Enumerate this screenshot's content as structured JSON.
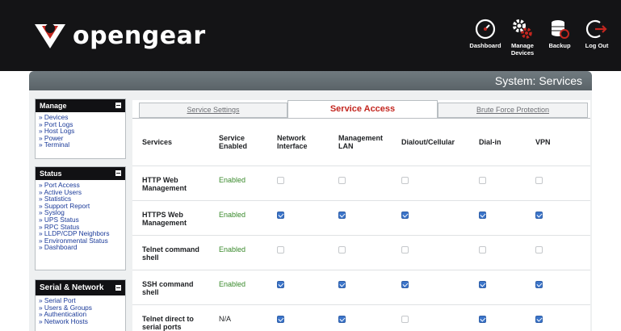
{
  "brand": {
    "name": "opengear"
  },
  "top_nav": [
    {
      "icon": "dashboard-gauge-icon",
      "label": "Dashboard"
    },
    {
      "icon": "manage-devices-gears-icon",
      "label": "Manage\nDevices"
    },
    {
      "icon": "backup-database-icon",
      "label": "Backup"
    },
    {
      "icon": "logout-arrow-icon",
      "label": "Log Out"
    }
  ],
  "page_title": "System: Services",
  "sidebar": {
    "manage": {
      "title": "Manage",
      "items": [
        "Devices",
        "Port Logs",
        "Host Logs",
        "Power",
        "Terminal"
      ]
    },
    "status": {
      "title": "Status",
      "items": [
        "Port Access",
        "Active Users",
        "Statistics",
        "Support Report",
        "Syslog",
        "UPS Status",
        "RPC Status",
        "LLDP/CDP Neighbors",
        "Environmental Status",
        "Dashboard"
      ]
    },
    "serial_network": {
      "title": "Serial & Network",
      "items": [
        "Serial Port",
        "Users & Groups",
        "Authentication",
        "Network Hosts"
      ]
    }
  },
  "tabs": [
    {
      "label": "Service Settings",
      "active": false
    },
    {
      "label": "Service Access",
      "active": true
    },
    {
      "label": "Brute Force Protection",
      "active": false
    }
  ],
  "table": {
    "columns": [
      "Services",
      "Service Enabled",
      "Network Interface",
      "Management LAN",
      "Dialout/Cellular",
      "Dial-in",
      "VPN"
    ],
    "rows": [
      {
        "service": "HTTP Web Management",
        "enabled": "Enabled",
        "checks": [
          false,
          false,
          false,
          false,
          false
        ]
      },
      {
        "service": "HTTPS Web Management",
        "enabled": "Enabled",
        "checks": [
          true,
          true,
          true,
          true,
          true
        ]
      },
      {
        "service": "Telnet command shell",
        "enabled": "Enabled",
        "checks": [
          false,
          false,
          false,
          false,
          false
        ]
      },
      {
        "service": "SSH command shell",
        "enabled": "Enabled",
        "checks": [
          true,
          true,
          true,
          true,
          true
        ]
      },
      {
        "service": "Telnet direct to serial ports",
        "enabled": "N/A",
        "checks": [
          true,
          true,
          false,
          true,
          true
        ]
      }
    ]
  },
  "colors": {
    "header_bg": "#141416",
    "active_tab_text": "#c3261f",
    "enabled_text": "#3a8a2c",
    "checkbox_checked": "#3b74c9",
    "link": "#1a3a99"
  }
}
